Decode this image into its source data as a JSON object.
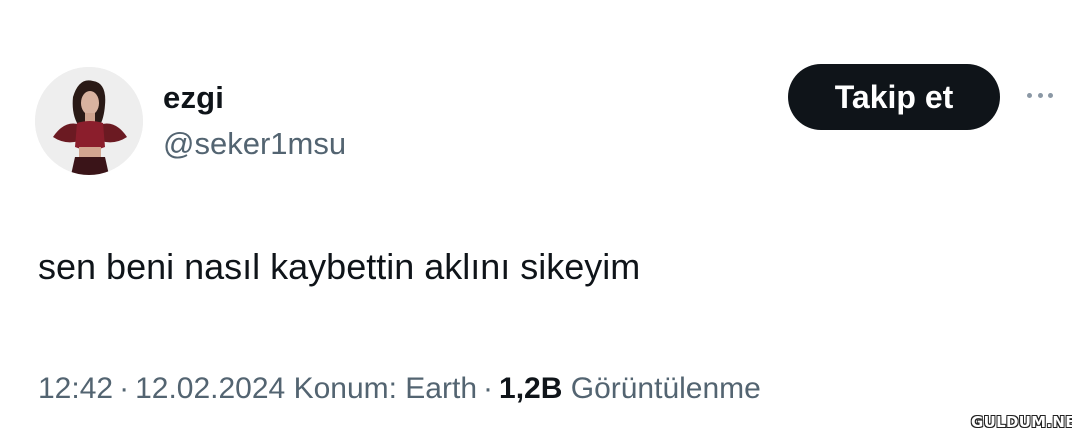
{
  "profile": {
    "display_name": "ezgi",
    "handle": "@seker1msu"
  },
  "follow_button": {
    "label": "Takip et"
  },
  "more_icon": "more-options-icon",
  "tweet": {
    "text": "sen beni nasıl kaybettin aklını sikeyim"
  },
  "meta": {
    "time": "12:42",
    "date": "12.02.2024",
    "location": "Konum: Earth",
    "views_count": "1,2B",
    "views_label": "Görüntülenme",
    "separator": "·"
  },
  "watermark": {
    "text": "GULDUM.NET"
  },
  "colors": {
    "text_primary": "#0f1419",
    "text_secondary": "#536471",
    "button_bg": "#0f1419",
    "button_text": "#ffffff",
    "background": "#ffffff"
  }
}
